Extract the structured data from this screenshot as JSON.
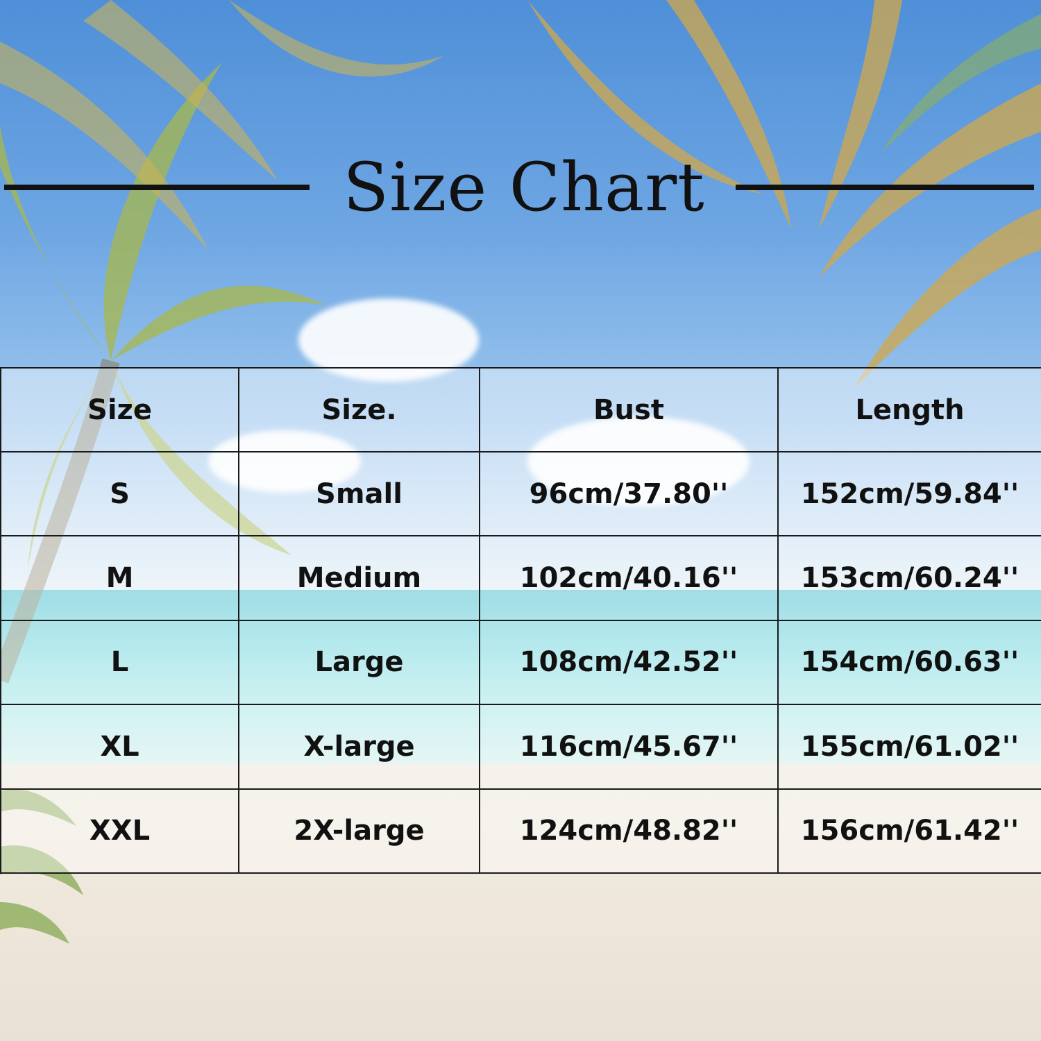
{
  "title": "Size Chart",
  "table": {
    "headers": [
      "Size",
      "Size.",
      "Bust",
      "Length"
    ],
    "rows": [
      [
        "S",
        "Small",
        "96cm/37.80''",
        "152cm/59.84''"
      ],
      [
        "M",
        "Medium",
        "102cm/40.16''",
        "153cm/60.24''"
      ],
      [
        "L",
        "Large",
        "108cm/42.52''",
        "154cm/60.63''"
      ],
      [
        "XL",
        "X-large",
        "116cm/45.67''",
        "155cm/61.02''"
      ],
      [
        "XXL",
        "2X-large",
        "124cm/48.82''",
        "156cm/61.42''"
      ]
    ]
  },
  "colors": {
    "text": "#111111",
    "sky": "#4f8fd8",
    "sea": "#5bc5d3",
    "sand": "#eee9e0",
    "palm": "#c9a94a"
  }
}
